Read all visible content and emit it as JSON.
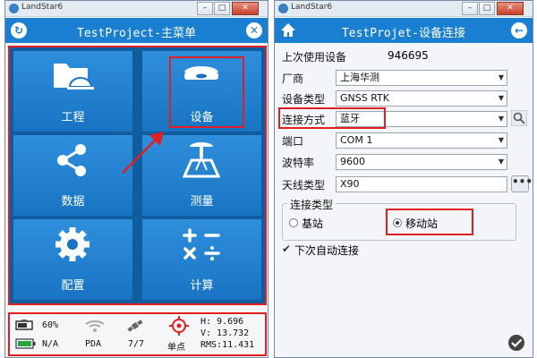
{
  "left_window": {
    "title": "LandStar6",
    "app_title": "TestProject-主菜单",
    "tiles": [
      {
        "label": "工程",
        "icon": "folder-hardhat-icon"
      },
      {
        "label": "设备",
        "icon": "gnss-receiver-icon"
      },
      {
        "label": "数据",
        "icon": "share-nodes-icon"
      },
      {
        "label": "测量",
        "icon": "survey-tripod-icon"
      },
      {
        "label": "配置",
        "icon": "gear-icon"
      },
      {
        "label": "计算",
        "icon": "calculator-icon"
      }
    ],
    "status": {
      "battery": "60%",
      "battery2": "N/A",
      "wifi_label": "PDA",
      "satellites": "7/7",
      "mode": "单点",
      "h": "H:  9.696",
      "v": "V: 13.732",
      "rms": "RMS:11.431"
    }
  },
  "right_window": {
    "title": "LandStar6",
    "app_title": "TestProjet-设备连接",
    "last_device_label": "上次使用设备",
    "last_device_value": "946695",
    "fields": [
      {
        "label": "厂商",
        "value": "上海华测"
      },
      {
        "label": "设备类型",
        "value": "GNSS RTK"
      },
      {
        "label": "连接方式",
        "value": "蓝牙"
      },
      {
        "label": "端口",
        "value": "COM 1"
      },
      {
        "label": "波特率",
        "value": "9600"
      },
      {
        "label": "天线类型",
        "value": "X90"
      }
    ],
    "connect_type_title": "连接类型",
    "radio_base": "基站",
    "radio_rover": "移动站",
    "auto_connect": "下次自动连接"
  },
  "colors": {
    "appbar": "#1a7fd0",
    "tile": "#1f7fd0",
    "highlight": "#e02020"
  }
}
